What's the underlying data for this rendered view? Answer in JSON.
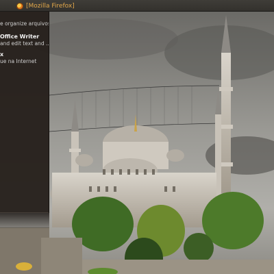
{
  "taskbar": {
    "window_title": "[Mozilla Firefox]",
    "icon": "firefox-icon"
  },
  "menu": {
    "items": [
      {
        "title": "",
        "desc": "e e organize arquivos"
      },
      {
        "title": "Office Writer",
        "desc": "and edit text and ..."
      },
      {
        "title": "x",
        "desc": "ue na Internet"
      }
    ],
    "search": {
      "value": "",
      "icon": "search-icon"
    }
  },
  "desktop": {
    "wallpaper": "blue-mosque-istanbul"
  },
  "colors": {
    "panel": "#33312d",
    "menu_bg": "#26201c",
    "title_accent": "#e3a84a",
    "sky": "#7a7a76"
  }
}
